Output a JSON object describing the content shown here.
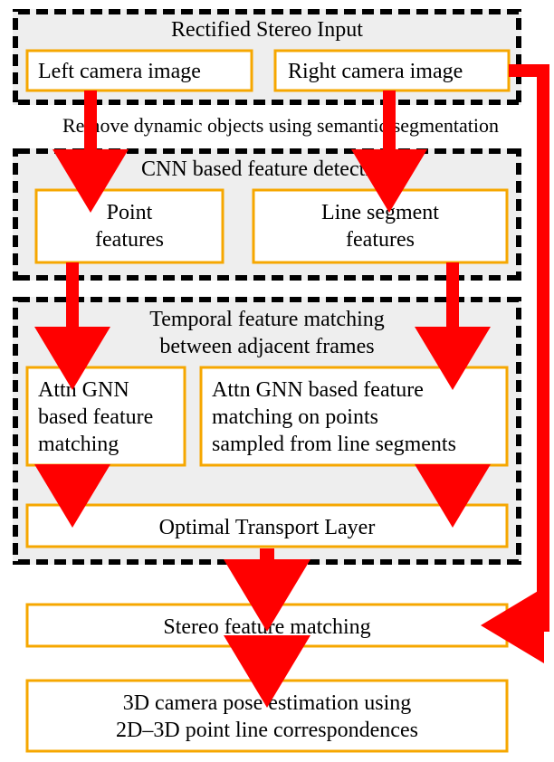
{
  "diagram": {
    "sections": {
      "input": {
        "title": "Rectified Stereo Input"
      },
      "featdet": {
        "title": "CNN based feature detection"
      },
      "temporal": {
        "title_line1": "Temporal feature matching",
        "title_line2": "between adjacent frames"
      }
    },
    "nodes": {
      "left_img": "Left camera image",
      "right_img": "Right camera image",
      "point_feats_l1": "Point",
      "point_feats_l2": "features",
      "line_feats_l1": "Line segment",
      "line_feats_l2": "features",
      "gnn_pt_l1": "Attn GNN",
      "gnn_pt_l2": "based feature",
      "gnn_pt_l3": "matching",
      "gnn_line_l1": "Attn GNN based feature",
      "gnn_line_l2": "matching on points",
      "gnn_line_l3": "sampled from line segments",
      "ot_layer": "Optimal Transport Layer",
      "stereo_match": "Stereo feature matching",
      "pose_l1": "3D camera pose estimation using",
      "pose_l2": "2D–3D point line correspondences"
    },
    "annotations": {
      "remove_dyn": "Remove dynamic objects using semantic segmentation"
    }
  }
}
